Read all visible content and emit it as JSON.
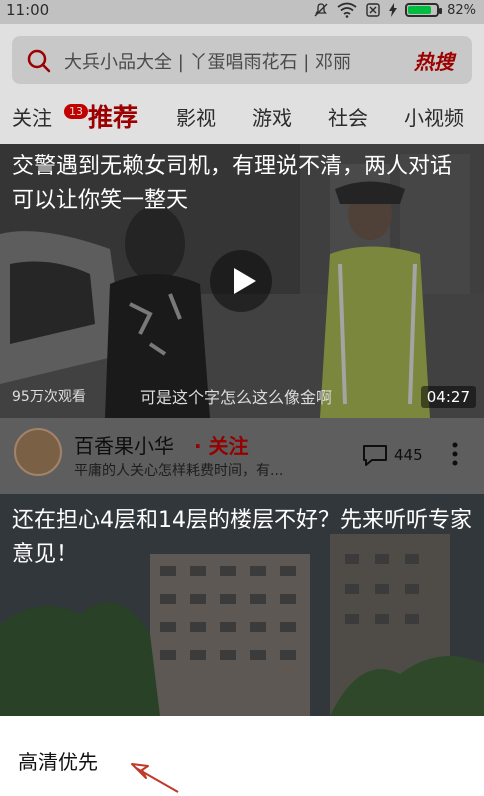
{
  "status_bar": {
    "time": "11:00",
    "battery": "82%",
    "battery_level": 0.82
  },
  "search": {
    "text": "大兵小品大全 | 丫蛋唱雨花石 | 邓丽",
    "hot_label": "热搜"
  },
  "tabs": [
    {
      "label": "关注",
      "badge": "13"
    },
    {
      "label": "推荐"
    },
    {
      "label": "影视"
    },
    {
      "label": "游戏"
    },
    {
      "label": "社会"
    },
    {
      "label": "小视频"
    }
  ],
  "video_card": {
    "title": "交警遇到无赖女司机，有理说不清，两人对话可以让你笑一整天",
    "views": "95万次观看",
    "subtitle": "可是这个字怎么这么像金啊",
    "duration": "04:27"
  },
  "author": {
    "name": "百香果小华",
    "follow": "· 关注",
    "desc": "平庸的人关心怎样耗费时间，有...",
    "comments": "445"
  },
  "building_card": {
    "title": "还在担心4层和14层的楼层不好？先来听听专家意见！"
  },
  "bottom_sheet": {
    "hd_label": "高清优先"
  },
  "colors": {
    "accent": "#b20000",
    "battery_fill": "#00d84b",
    "overlay": "#6c6c6c"
  }
}
